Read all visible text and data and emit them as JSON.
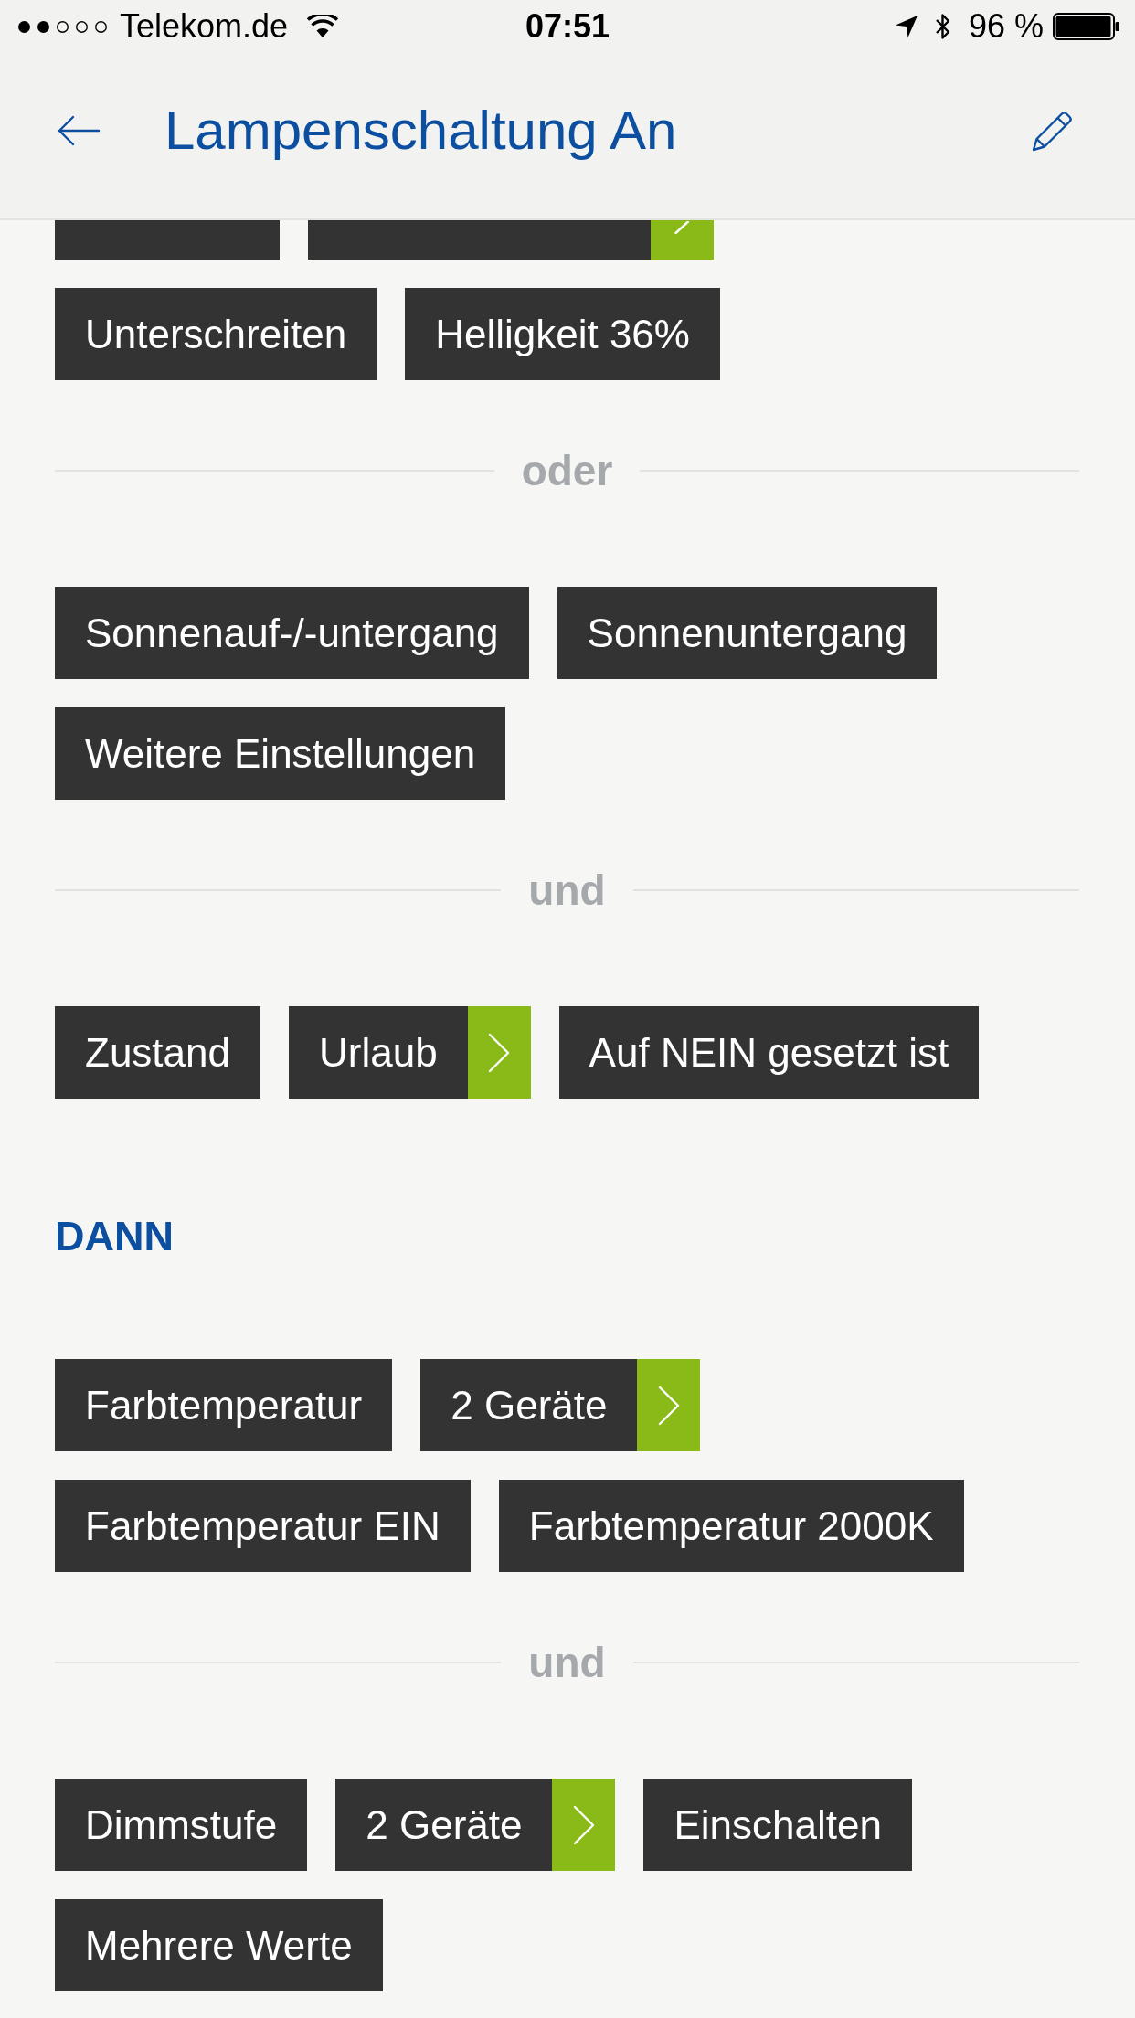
{
  "status_bar": {
    "carrier": "Telekom.de",
    "time": "07:51",
    "battery": "96 %"
  },
  "header": {
    "title": "Lampenschaltung An"
  },
  "content": [
    {
      "kind": "chip_row",
      "clipped": true,
      "chips": [
        {
          "arrow": false
        },
        {
          "arrow": true
        }
      ]
    },
    {
      "kind": "chip_row",
      "clipped": false,
      "chips": [
        {
          "label": "Unterschreiten",
          "arrow": false
        },
        {
          "label": "Helligkeit 36%",
          "arrow": false
        }
      ]
    },
    {
      "kind": "divider",
      "label": "oder"
    },
    {
      "kind": "chip_row",
      "clipped": false,
      "chips": [
        {
          "label": "Sonnenauf-/-untergang",
          "arrow": false
        },
        {
          "label": "Sonnenuntergang",
          "arrow": false
        }
      ]
    },
    {
      "kind": "chip_row",
      "clipped": false,
      "chips": [
        {
          "label": "Weitere Einstellungen",
          "arrow": false
        }
      ]
    },
    {
      "kind": "divider",
      "label": "und"
    },
    {
      "kind": "chip_row",
      "clipped": false,
      "chips": [
        {
          "label": "Zustand",
          "arrow": false
        },
        {
          "label": "Urlaub",
          "arrow": true
        },
        {
          "label": "Auf NEIN gesetzt ist",
          "arrow": false
        }
      ]
    },
    {
      "kind": "heading",
      "label": "DANN"
    },
    {
      "kind": "chip_row",
      "clipped": false,
      "chips": [
        {
          "label": "Farbtemperatur",
          "arrow": false
        },
        {
          "label": "2 Geräte",
          "arrow": true
        }
      ]
    },
    {
      "kind": "chip_row",
      "clipped": false,
      "chips": [
        {
          "label": "Farbtemperatur EIN",
          "arrow": false
        },
        {
          "label": "Farbtemperatur 2000K",
          "arrow": false
        }
      ]
    },
    {
      "kind": "divider",
      "label": "und"
    },
    {
      "kind": "chip_row",
      "clipped": false,
      "chips": [
        {
          "label": "Dimmstufe",
          "arrow": false
        },
        {
          "label": "2 Geräte",
          "arrow": true
        },
        {
          "label": "Einschalten",
          "arrow": false
        }
      ]
    },
    {
      "kind": "chip_row",
      "clipped": false,
      "chips": [
        {
          "label": "Mehrere Werte",
          "arrow": false
        }
      ]
    }
  ]
}
